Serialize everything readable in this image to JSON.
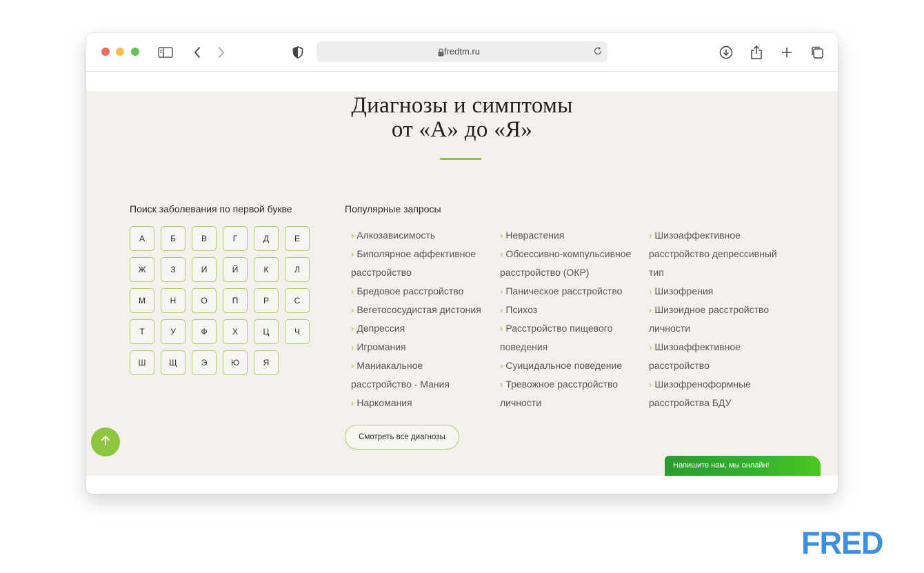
{
  "browser": {
    "url": "fredtm.ru"
  },
  "page": {
    "title_line1": "Диагнозы и симптомы",
    "title_line2": "от «А» до «Я»",
    "letters_heading": "Поиск заболевания по первой букве",
    "letters": [
      "А",
      "Б",
      "В",
      "Г",
      "Д",
      "Е",
      "Ж",
      "З",
      "И",
      "Й",
      "К",
      "Л",
      "М",
      "Н",
      "О",
      "П",
      "Р",
      "С",
      "Т",
      "У",
      "Ф",
      "Х",
      "Ц",
      "Ч",
      "Ш",
      "Щ",
      "Э",
      "Ю",
      "Я"
    ],
    "popular_heading": "Популярные запросы",
    "popular_columns": [
      [
        "Алкозависимость",
        "Биполярное аффективное",
        "расстройство",
        "Бредовое расстройство",
        "Вегетососудистая дистония",
        "Депрессия",
        "Игромания",
        "Маниакальное",
        "расстройство - Мания",
        "Наркомания"
      ],
      [
        "Неврастения",
        "Обсессивно-компульсивное",
        "расстройство (ОКР)",
        "Паническое расстройство",
        "Психоз",
        "Расстройство пищевого",
        "поведения",
        "Суицидальное поведение",
        "Тревожное расстройство",
        "личности"
      ],
      [
        "Шизоаффективное",
        "расстройство депрессивный",
        "тип",
        "Шизофрения",
        "Шизоидное расстройство",
        "личности",
        "Шизоаффективное",
        "расстройство",
        "Шизофреноформные",
        "расстройства БДУ"
      ]
    ],
    "all_button": "Смотреть все диагнозы",
    "chat_label": "Напишите нам, мы онлайн!"
  },
  "watermark": "FRED",
  "colors": {
    "accent": "#8cc63f",
    "page_bg": "#f4f1ec",
    "chat_green": "#2e9a2e",
    "watermark_blue": "#3b8fe0"
  }
}
